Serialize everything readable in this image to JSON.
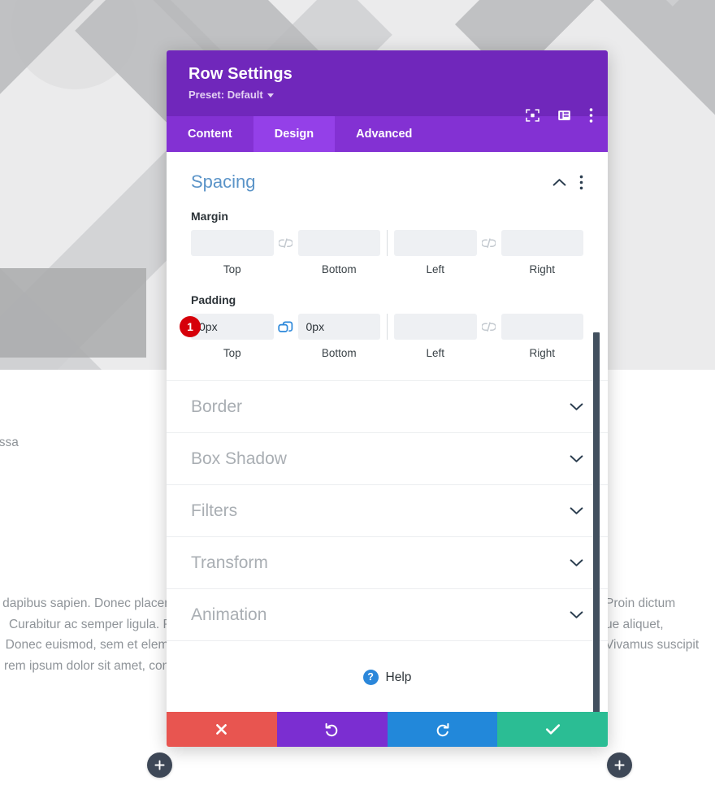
{
  "background": {
    "text_lines": {
      "line1": "at massa",
      "line2": "s",
      "left_block": [
        "dapibus sapien. Donec placera",
        "Curabitur ac semper ligula. Pr",
        "Donec euismod, sem et eleme",
        "rem ipsum dolor sit amet, cons"
      ],
      "right_block": [
        "Proin dictum",
        "ue aliquet,",
        "Vivamus suscipit"
      ]
    },
    "add_button_left": {
      "name": "add-row-button-left",
      "icon": "plus-icon"
    },
    "add_button_right": {
      "name": "add-row-button-right",
      "icon": "plus-icon"
    }
  },
  "modal": {
    "title": "Row Settings",
    "preset_label": "Preset: Default",
    "header_icons": [
      {
        "name": "focus-target-icon",
        "label": "Focus"
      },
      {
        "name": "layout-panel-icon",
        "label": "Panel Layout"
      },
      {
        "name": "vertical-dots-icon",
        "label": "More Options"
      }
    ],
    "tabs": [
      {
        "label": "Content",
        "active": false
      },
      {
        "label": "Design",
        "active": true
      },
      {
        "label": "Advanced",
        "active": false
      }
    ],
    "spacing": {
      "title": "Spacing",
      "collapse_icon": "chevron-up-icon",
      "more_icon": "vertical-dots-icon",
      "margin": {
        "label": "Margin",
        "link_state_vertical": "unlinked",
        "link_state_horizontal": "unlinked",
        "fields": [
          {
            "caption": "Top",
            "value": "",
            "placeholder": ""
          },
          {
            "caption": "Bottom",
            "value": "",
            "placeholder": ""
          },
          {
            "caption": "Left",
            "value": "",
            "placeholder": ""
          },
          {
            "caption": "Right",
            "value": "",
            "placeholder": ""
          }
        ]
      },
      "padding": {
        "label": "Padding",
        "badge": "1",
        "link_state_vertical": "linked",
        "link_state_horizontal": "unlinked",
        "fields": [
          {
            "caption": "Top",
            "value": "0px",
            "placeholder": ""
          },
          {
            "caption": "Bottom",
            "value": "0px",
            "placeholder": ""
          },
          {
            "caption": "Left",
            "value": "",
            "placeholder": ""
          },
          {
            "caption": "Right",
            "value": "",
            "placeholder": ""
          }
        ]
      }
    },
    "sections": [
      {
        "title": "Border",
        "icon": "chevron-down-icon"
      },
      {
        "title": "Box Shadow",
        "icon": "chevron-down-icon"
      },
      {
        "title": "Filters",
        "icon": "chevron-down-icon"
      },
      {
        "title": "Transform",
        "icon": "chevron-down-icon"
      },
      {
        "title": "Animation",
        "icon": "chevron-down-icon"
      }
    ],
    "help": {
      "label": "Help",
      "icon": "question-mark-icon",
      "icon_glyph": "?"
    },
    "footer_buttons": [
      {
        "name": "cancel-button",
        "icon": "close-x-icon",
        "label": "Cancel"
      },
      {
        "name": "undo-button",
        "icon": "undo-icon",
        "label": "Undo"
      },
      {
        "name": "redo-button",
        "icon": "redo-icon",
        "label": "Redo"
      },
      {
        "name": "save-button",
        "icon": "checkmark-icon",
        "label": "Save"
      }
    ]
  },
  "colors": {
    "header_purple": "#7027BB",
    "tabs_purple": "#8331D3",
    "tab_active_purple": "#9440E8",
    "panel_title_blue": "#5B94C8",
    "badge_red": "#D6000A",
    "link_active_blue": "#2B87DA",
    "cancel_red": "#E85550",
    "undo_purple": "#7B2ED1",
    "redo_blue": "#2288DA",
    "save_green": "#2BBD94",
    "scrollbar": "#42505F"
  }
}
